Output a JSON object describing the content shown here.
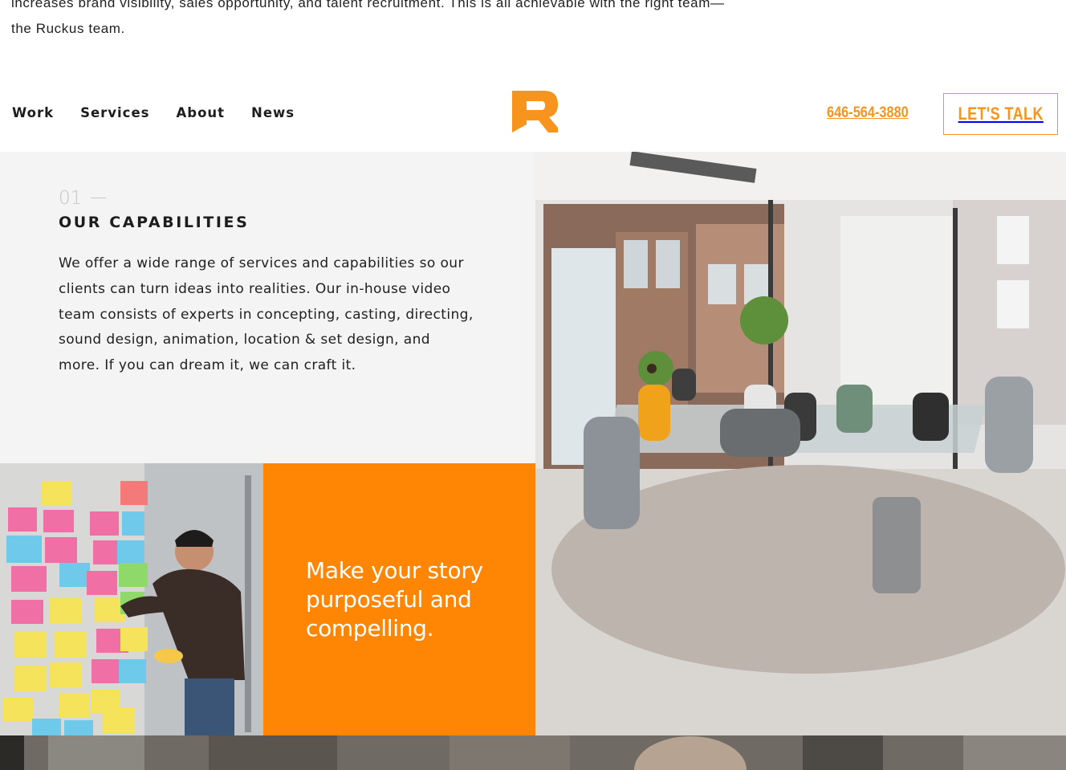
{
  "intro": {
    "line1": "increases brand visibility, sales opportunity, and talent recruitment. This is all achievable with the right team—",
    "line2": "the Ruckus team."
  },
  "header": {
    "nav": [
      "Work",
      "Services",
      "About",
      "News"
    ],
    "logo_letter": "R",
    "phone": "646-564-3880",
    "cta_label": "LET'S TALK"
  },
  "capabilities": {
    "number": "01",
    "title": "OUR CAPABILITIES",
    "body": "We offer a wide range of services and capabilities so our clients can turn ideas into realities. Our in-house video team consists of experts in concepting, casting, directing, sound design, animation, location & set design, and more. If you can dream it, we can craft it."
  },
  "feature": {
    "tagline": "Make your story purposeful and compelling."
  },
  "colors": {
    "accent": "#f7941d",
    "panel_orange": "#ff8605",
    "panel_gray": "#f4f4f4"
  }
}
